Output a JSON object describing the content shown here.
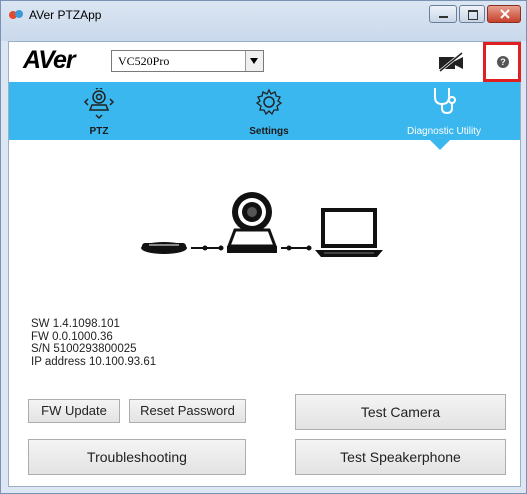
{
  "window": {
    "title": "AVer PTZApp",
    "logo": "AVer"
  },
  "toolbar": {
    "camera_select_value": "VC520Pro",
    "help_glyph": "?"
  },
  "nav": {
    "items": [
      {
        "label": "PTZ",
        "icon": "ptz-camera-icon"
      },
      {
        "label": "Settings",
        "icon": "gear-icon"
      },
      {
        "label": "Diagnostic Utility",
        "icon": "stethoscope-icon"
      }
    ],
    "active": "Diagnostic Utility"
  },
  "info": {
    "sw": "SW 1.4.1098.101",
    "fw": "FW 0.0.1000.36",
    "sn": "S/N 5100293800025",
    "ip": "IP address 10.100.93.61"
  },
  "buttons": {
    "fw_update": "FW Update",
    "reset_password": "Reset Password",
    "test_camera": "Test Camera",
    "troubleshooting": "Troubleshooting",
    "test_speakerphone": "Test Speakerphone"
  },
  "colors": {
    "nav_bg": "#3ab7ee",
    "highlight_border": "#e02020"
  }
}
